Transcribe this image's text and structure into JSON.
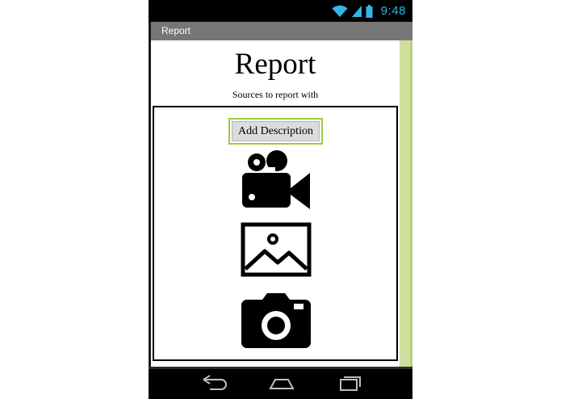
{
  "status_bar": {
    "time": "9:48",
    "icons": [
      "wifi-icon",
      "cell-signal-icon",
      "battery-icon"
    ],
    "time_color": "#33b5e5"
  },
  "title_bar": {
    "title": "Report",
    "background": "#767676"
  },
  "main": {
    "title": "Report",
    "subtitle": "Sources to report with",
    "add_description_label": "Add Description",
    "media_buttons": [
      "video-camera-icon",
      "image-icon",
      "photo-camera-icon"
    ]
  },
  "colors": {
    "scrollbar": "#cfe09e",
    "button_focus_border": "#9ccc3c"
  },
  "nav_bar": {
    "buttons": [
      "back-icon",
      "home-icon",
      "recent-apps-icon"
    ]
  }
}
